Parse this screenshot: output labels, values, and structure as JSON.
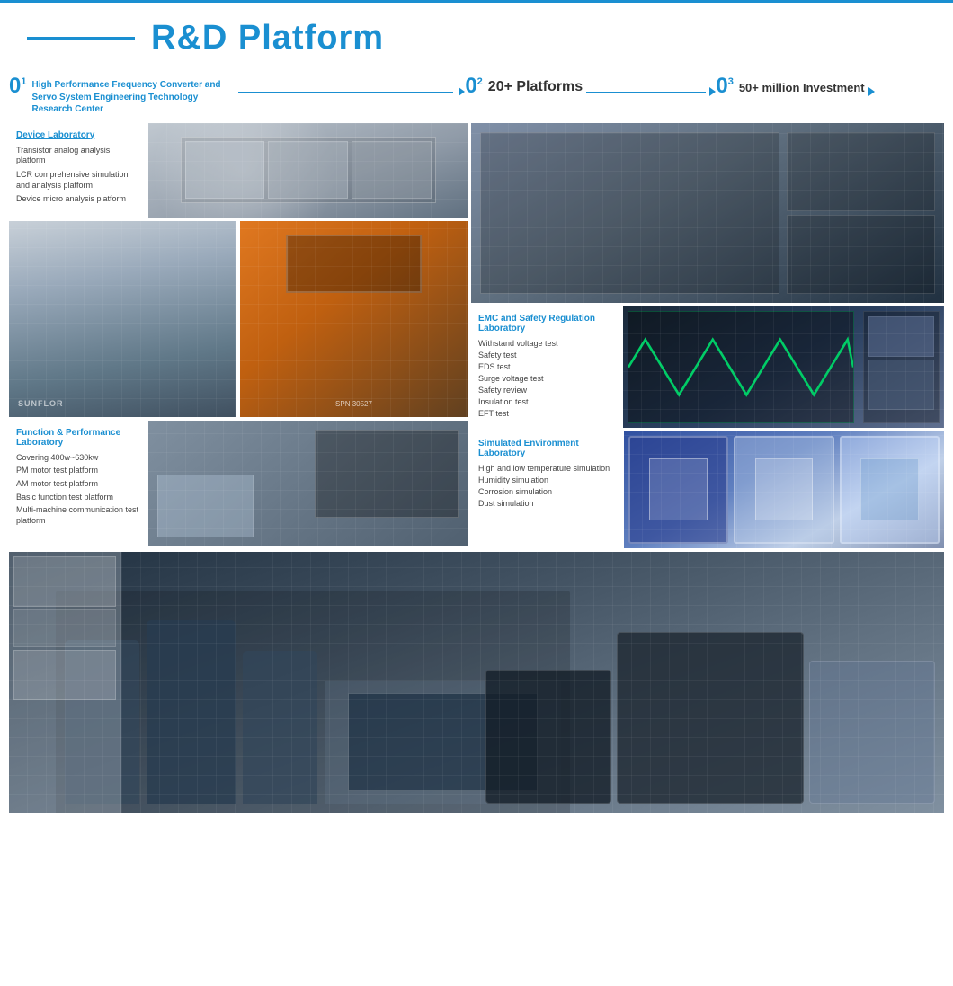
{
  "page": {
    "title": "R&D Platform",
    "header_line_decoration": true
  },
  "sections": {
    "s01": {
      "number": "01",
      "label": "High Performance Frequency Converter and Servo System Engineering Technology Research Center",
      "has_arrow": true
    },
    "s02": {
      "number": "02",
      "label": "20+ Platforms",
      "has_arrow": true
    },
    "s03": {
      "number": "03",
      "label": "50+ million Investment",
      "has_arrow": true
    }
  },
  "labs": {
    "device_lab": {
      "title": "Device Laboratory",
      "items": [
        "Transistor analog analysis platform",
        "LCR comprehensive simulation and analysis platform",
        "Device micro analysis platform"
      ]
    },
    "function_lab": {
      "title": "Function & Performance Laboratory",
      "items": [
        "Covering 400w~630kw",
        "PM motor test platform",
        "AM motor test platform",
        "Basic function test platform",
        "Multi-machine communication test platform"
      ]
    },
    "emc_lab": {
      "title": "EMC and Safety Regulation Laboratory",
      "items": [
        "Withstand voltage test",
        "Safety test",
        "EDS test",
        "Surge voltage test",
        "Safety review",
        "Insulation test",
        "EFT test"
      ]
    },
    "sim_lab": {
      "title": "Simulated Environment Laboratory",
      "items": [
        "High and low temperature simulation",
        "Humidity simulation",
        "Corrosion simulation",
        "Dust simulation"
      ]
    }
  }
}
